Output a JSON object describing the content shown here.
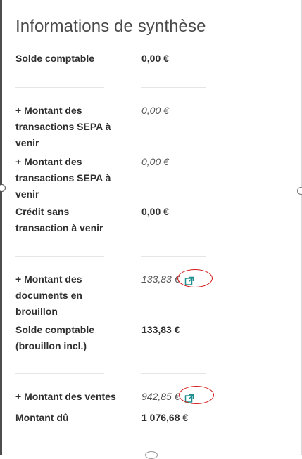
{
  "panel": {
    "title": "Informations de synthèse"
  },
  "rows": [
    {
      "label": "Solde comptable",
      "value": "0,00 €"
    },
    {
      "label": "+ Montant des transactions SEPA à venir",
      "value": "0,00 €"
    },
    {
      "label": "+ Montant des transactions SEPA à venir",
      "value": "0,00 €"
    },
    {
      "label": "Crédit sans transaction à venir",
      "value": "0,00 €"
    },
    {
      "label": "+ Montant des documents en brouillon",
      "value": "133,83 €"
    },
    {
      "label": "Solde comptable (brouillon incl.)",
      "value": "133,83 €"
    },
    {
      "label": "+ Montant des ventes",
      "value": "942,85 €"
    },
    {
      "label": "Montant dû",
      "value": "1 076,68 €"
    }
  ],
  "icons": {
    "external_link": "external-link-icon"
  },
  "colors": {
    "annotation_circle": "#d41a1a",
    "link_icon": "#1f8f8f"
  }
}
